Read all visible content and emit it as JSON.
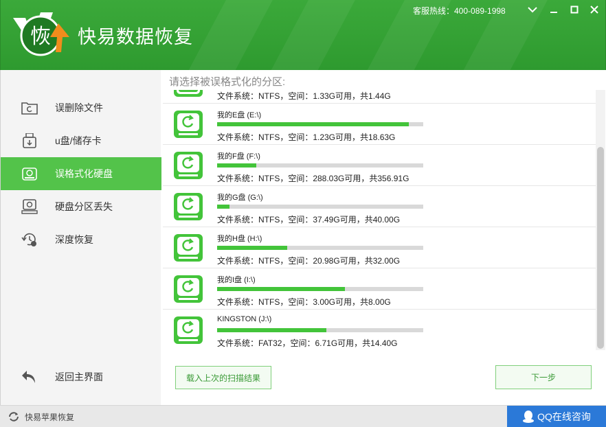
{
  "header": {
    "app_title": "快易数据恢复",
    "logo_char": "恢",
    "hotline": "客服热线：400-089-1998"
  },
  "window_controls": [
    "chevron-down-icon",
    "minimize-icon",
    "maximize-icon",
    "close-icon"
  ],
  "sidebar": {
    "items": [
      {
        "label": "误删除文件",
        "icon": "folder-recover-icon",
        "active": false
      },
      {
        "label": "u盘/储存卡",
        "icon": "usb-drive-icon",
        "active": false
      },
      {
        "label": "误格式化硬盘",
        "icon": "hard-disk-icon",
        "active": true
      },
      {
        "label": "硬盘分区丢失",
        "icon": "disk-partition-icon",
        "active": false
      },
      {
        "label": "深度恢复",
        "icon": "deep-recover-icon",
        "active": false
      }
    ],
    "back_label": "返回主界面"
  },
  "main": {
    "title": "请选择被误格式化的分区:",
    "top_partial_info": "文件系统：NTFS，空间：1.33G可用，共1.44G",
    "partitions": [
      {
        "name": "我的E盘 (E:\\)",
        "info": "文件系统：NTFS，空间：1.23G可用，共18.63G",
        "used_fraction": 0.93
      },
      {
        "name": "我的F盘 (F:\\)",
        "info": "文件系统：NTFS，空间：288.03G可用，共356.91G",
        "used_fraction": 0.19
      },
      {
        "name": "我的G盘 (G:\\)",
        "info": "文件系统：NTFS，空间：37.49G可用，共40.00G",
        "used_fraction": 0.06
      },
      {
        "name": "我的H盘 (H:\\)",
        "info": "文件系统：NTFS，空间：20.98G可用，共32.00G",
        "used_fraction": 0.34
      },
      {
        "name": "我的I盘 (I:\\)",
        "info": "文件系统：NTFS，空间：3.00G可用，共8.00G",
        "used_fraction": 0.62
      },
      {
        "name": "KINGSTON (J:\\)",
        "info": "文件系统：FAT32，空间：6.71G可用，共14.40G",
        "used_fraction": 0.53
      }
    ],
    "load_button": "载入上次的扫描结果",
    "next_button": "下一步"
  },
  "footer": {
    "apple_label": "快易苹果恢复",
    "qq_label": "QQ在线咨询"
  },
  "colors": {
    "brand_green": "#2e9a2f",
    "active_green": "#53c34a",
    "bar_green": "#43c43a",
    "qq_blue": "#2b79d8"
  }
}
